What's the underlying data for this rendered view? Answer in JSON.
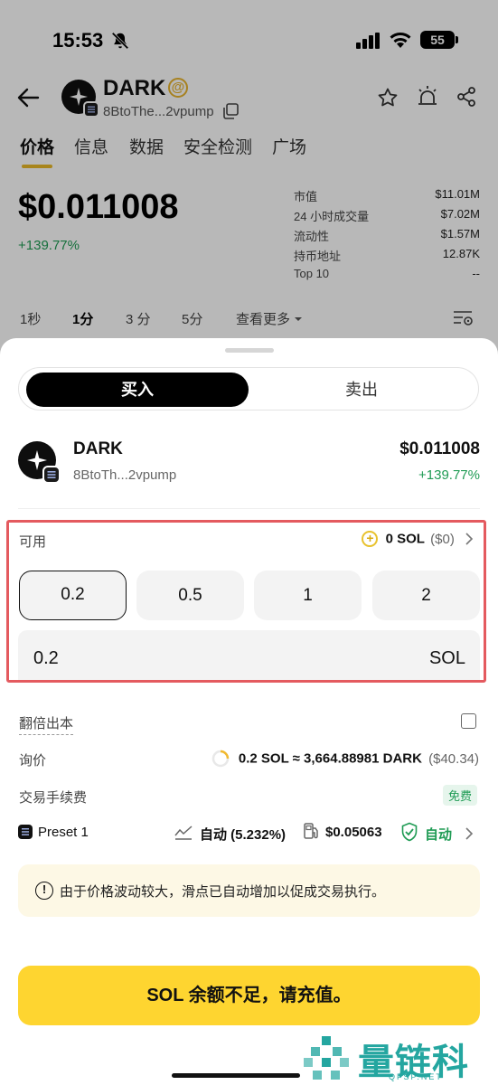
{
  "status_bar": {
    "time": "15:53",
    "battery": "55"
  },
  "header": {
    "token_name": "DARK",
    "address": "8BtoThe...2vpump"
  },
  "tabs": [
    "价格",
    "信息",
    "数据",
    "安全检测",
    "广场"
  ],
  "price": {
    "value": "$0.011008",
    "change": "+139.77%"
  },
  "stats": [
    {
      "label": "市值",
      "value": "$11.01M"
    },
    {
      "label": "24 小时成交量",
      "value": "$7.02M"
    },
    {
      "label": "流动性",
      "value": "$1.57M"
    },
    {
      "label": "持币地址",
      "value": "12.87K"
    },
    {
      "label": "Top 10",
      "value": "--"
    }
  ],
  "intervals": [
    "1秒",
    "1分",
    "3 分",
    "5分",
    "查看更多"
  ],
  "sheet": {
    "buy_label": "买入",
    "sell_label": "卖出",
    "token": {
      "name": "DARK",
      "address": "8BtoTh...2vpump",
      "price": "$0.011008",
      "change": "+139.77%"
    },
    "available": {
      "label": "可用",
      "sol": "0 SOL",
      "usd": "($0)"
    },
    "amount_options": [
      "0.2",
      "0.5",
      "1",
      "2"
    ],
    "amount": {
      "value": "0.2",
      "unit": "SOL"
    },
    "double_label": "翻倍出本",
    "quote": {
      "label": "询价",
      "text": "0.2 SOL ≈ 3,664.88981 DARK",
      "usd": "($40.34)"
    },
    "fee": {
      "label": "交易手续费",
      "badge": "免费"
    },
    "preset": {
      "label": "Preset 1",
      "slippage": "自动 (5.232%)",
      "gas": "$0.05063",
      "mev": "自动"
    },
    "warning": "由于价格波动较大，滑点已自动增加以促成交易执行。",
    "cta": "SOL 余额不足，请充值。"
  },
  "watermark": {
    "title": "量链科技",
    "sub": "QFSP.NET"
  },
  "colors": {
    "accent_yellow": "#fed530",
    "positive_green": "#1f9b54",
    "highlight_red": "#e45a5f"
  }
}
